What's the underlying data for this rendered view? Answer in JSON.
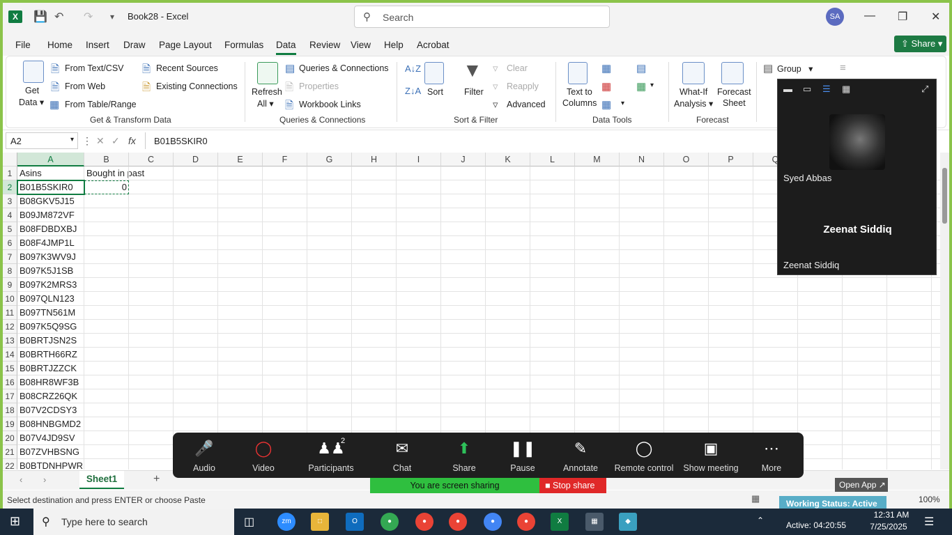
{
  "title_bar": {
    "app_icon": "X",
    "doc_title": "Book28 - Excel",
    "search_placeholder": "Search",
    "avatar": "SA"
  },
  "menu": {
    "tabs": [
      "File",
      "Home",
      "Insert",
      "Draw",
      "Page Layout",
      "Formulas",
      "Data",
      "Review",
      "View",
      "Help",
      "Acrobat"
    ],
    "active_tab": "Data",
    "share_label": "Share"
  },
  "ribbon": {
    "get_transform": {
      "get_data": "Get",
      "get_data2": "Data",
      "from_text": "From Text/CSV",
      "from_web": "From Web",
      "from_table": "From Table/Range",
      "recent_sources": "Recent Sources",
      "existing_connections": "Existing Connections",
      "group_label": "Get & Transform Data"
    },
    "queries": {
      "refresh": "Refresh",
      "refresh_all": "All",
      "queries_connections": "Queries & Connections",
      "properties": "Properties",
      "workbook_links": "Workbook Links",
      "group_label": "Queries & Connections"
    },
    "sort_filter": {
      "sort": "Sort",
      "filter": "Filter",
      "clear": "Clear",
      "reapply": "Reapply",
      "advanced": "Advanced",
      "group_label": "Sort & Filter"
    },
    "data_tools": {
      "text_to": "Text to",
      "columns": "Columns",
      "group_label": "Data Tools"
    },
    "forecast": {
      "what_if": "What-If",
      "analysis": "Analysis",
      "forecast_sheet": "Forecast",
      "sheet": "Sheet",
      "group_label": "Forecast"
    },
    "outline": {
      "group": "Group"
    }
  },
  "formula_bar": {
    "name_box": "A2",
    "formula": "B01B5SKIR0"
  },
  "grid": {
    "columns": [
      "A",
      "B",
      "C",
      "D",
      "E",
      "F",
      "G",
      "H",
      "I",
      "J",
      "K",
      "L",
      "M",
      "N",
      "O",
      "P",
      "Q"
    ],
    "rows": [
      "1",
      "2",
      "3",
      "4",
      "5",
      "6",
      "7",
      "8",
      "9",
      "10",
      "11",
      "12",
      "13",
      "14",
      "15",
      "16",
      "17",
      "18",
      "19",
      "20",
      "21",
      "22"
    ],
    "headers": {
      "a1": "Asins",
      "b1": "Bought in past"
    },
    "b2_value": "0",
    "asins": [
      "B01B5SKIR0",
      "B08GKV5J15",
      "B09JM872VF",
      "B08FDBDXBJ",
      "B08F4JMP1L",
      "B097K3WV9J",
      "B097K5J1SB",
      "B097K2MRS3",
      "B097QLN123",
      "B097TN561M",
      "B097K5Q9SG",
      "B0BRTJSN2S",
      "B0BRTH66RZ",
      "B0BRTJZZCK",
      "B08HR8WF3B",
      "B08CRZ26QK",
      "B07V2CDSY3",
      "B08HNBGMD2",
      "B07V4JD9SV",
      "B07ZVHBSNG",
      "B0BTDNHPWR"
    ]
  },
  "sheet_tabs": {
    "active": "Sheet1",
    "add": "+"
  },
  "status_bar": {
    "message": "Select destination and press ENTER or choose Paste",
    "zoom": "100%"
  },
  "zoom_panel": {
    "participant1": "Syed Abbas",
    "participant2_big": "Zeenat Siddiq",
    "participant2": "Zeenat Siddiq"
  },
  "zoom_toolbar": {
    "items": [
      "Audio",
      "Video",
      "Participants",
      "Chat",
      "Share",
      "Pause",
      "Annotate",
      "Remote control",
      "Show meeting",
      "More"
    ],
    "participants_count": "2",
    "sharing_text": "You are screen sharing",
    "stop_share": "Stop share",
    "open_app": "Open App",
    "working_status": "Working Status: Active"
  },
  "taskbar": {
    "search_placeholder": "Type here to search",
    "time": "12:31 AM",
    "date": "7/25/2025",
    "active_timer": "Active: 04:20:55"
  }
}
